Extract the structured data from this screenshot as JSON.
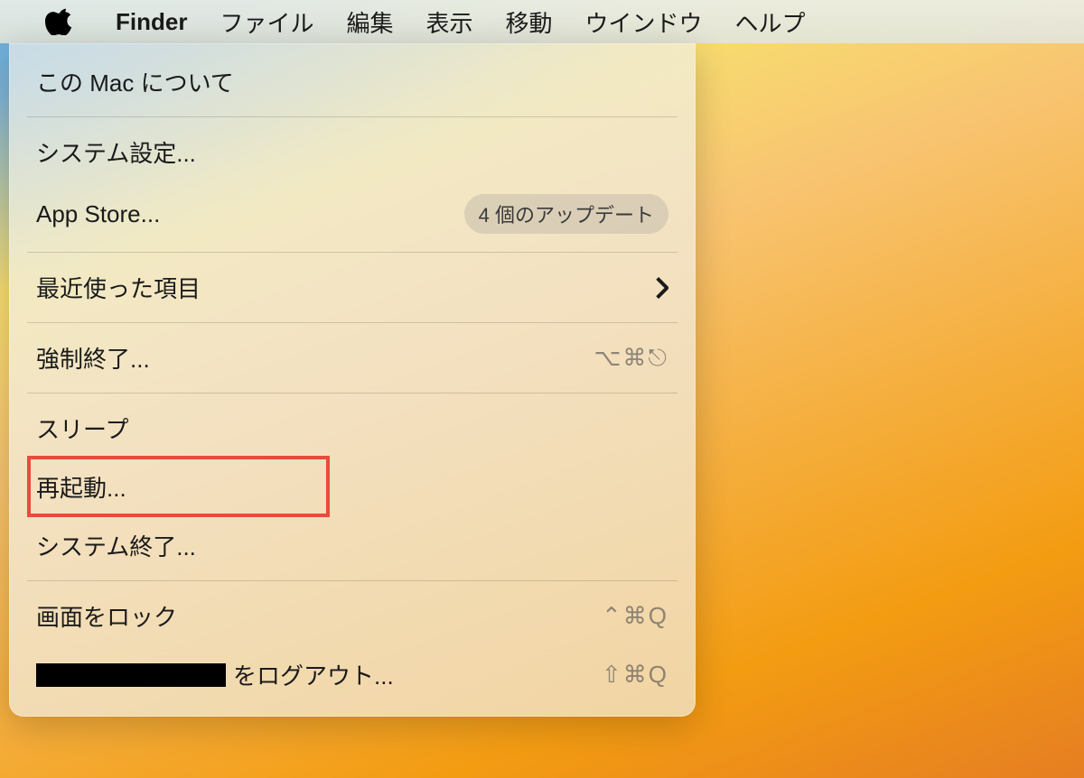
{
  "menubar": {
    "app_name": "Finder",
    "items": [
      "ファイル",
      "編集",
      "表示",
      "移動",
      "ウインドウ",
      "ヘルプ"
    ]
  },
  "apple_menu": {
    "about": "この Mac について",
    "system_settings": "システム設定...",
    "app_store": "App Store...",
    "app_store_badge": "4 個のアップデート",
    "recent_items": "最近使った項目",
    "force_quit": "強制終了...",
    "force_quit_shortcut": "⌥⌘⎋",
    "sleep": "スリープ",
    "restart": "再起動...",
    "shutdown": "システム終了...",
    "lock_screen": "画面をロック",
    "lock_screen_shortcut": "⌃⌘Q",
    "logout_suffix": " をログアウト...",
    "logout_shortcut": "⇧⌘Q"
  },
  "highlight": {
    "target": "restart"
  }
}
